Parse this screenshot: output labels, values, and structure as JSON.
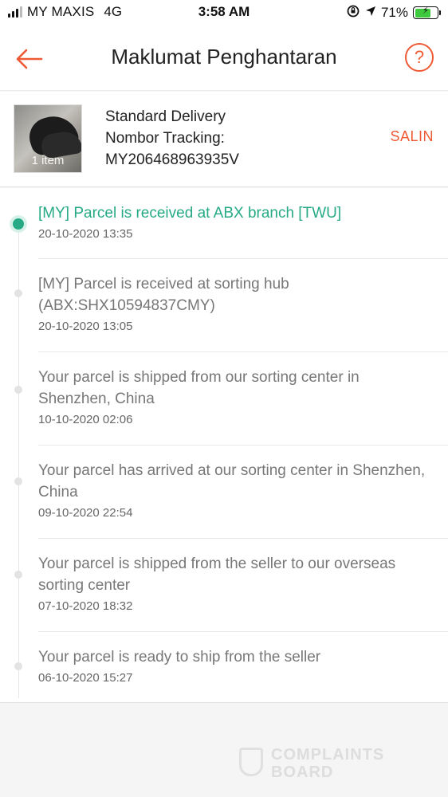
{
  "status_bar": {
    "carrier": "MY MAXIS",
    "network": "4G",
    "time": "3:58 AM",
    "battery": "71%",
    "battery_level": 0.71
  },
  "header": {
    "title": "Maklumat Penghantaran",
    "help_symbol": "?"
  },
  "shipment": {
    "item_count": "1 item",
    "delivery_type": "Standard Delivery",
    "tracking_label": "Nombor Tracking:",
    "tracking_number": "MY206468963935V",
    "copy_label": "SALIN"
  },
  "events": [
    {
      "text": "[MY] Parcel is received at ABX branch [TWU]",
      "time": "20-10-2020 13:35",
      "active": true
    },
    {
      "text": "[MY] Parcel is received at sorting hub (ABX:SHX10594837CMY)",
      "time": "20-10-2020 13:05"
    },
    {
      "text": "Your parcel is shipped from our sorting center in Shenzhen, China",
      "time": "10-10-2020 02:06"
    },
    {
      "text": "Your parcel has arrived at our sorting center in Shenzhen, China",
      "time": "09-10-2020 22:54"
    },
    {
      "text": "Your parcel is shipped from the seller to our overseas sorting center",
      "time": "07-10-2020 18:32"
    },
    {
      "text": "Your parcel is ready to ship from the seller",
      "time": "06-10-2020 15:27"
    }
  ],
  "watermark": {
    "line1": "COMPLAINTS",
    "line2": "BOARD"
  },
  "colors": {
    "accent": "#ee5a35",
    "active_green": "#26aa85",
    "battery_green": "#3ec93e"
  }
}
